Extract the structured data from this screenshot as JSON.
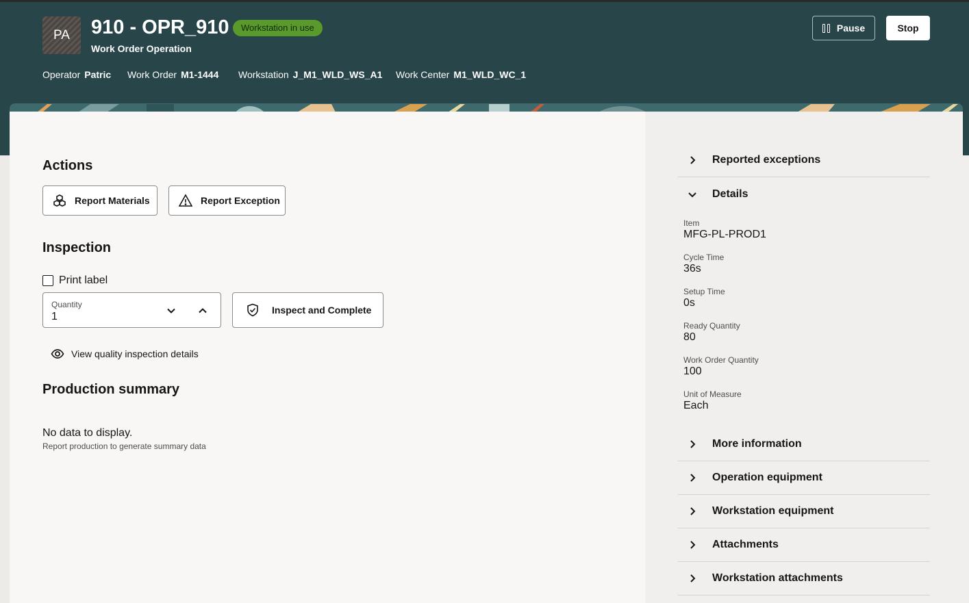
{
  "header": {
    "avatar_initials": "PA",
    "title": "910 - OPR_910",
    "status_badge": "Workstation in use",
    "subtitle": "Work Order Operation",
    "meta": [
      {
        "label": "Operator",
        "value": "Patric"
      },
      {
        "label": "Work Order",
        "value": "M1-1444"
      },
      {
        "label": "Workstation",
        "value": "J_M1_WLD_WS_A1"
      },
      {
        "label": "Work Center",
        "value": "M1_WLD_WC_1"
      }
    ],
    "pause_label": "Pause",
    "stop_label": "Stop"
  },
  "actions": {
    "heading": "Actions",
    "report_materials": "Report Materials",
    "report_exception": "Report Exception"
  },
  "inspection": {
    "heading": "Inspection",
    "print_label": "Print label",
    "print_label_checked": false,
    "quantity_label": "Quantity",
    "quantity_value": "1",
    "inspect_complete": "Inspect and Complete",
    "view_details": "View quality inspection details"
  },
  "production_summary": {
    "heading": "Production summary",
    "empty_title": "No data to display.",
    "empty_subtitle": "Report production to generate summary data"
  },
  "side_panel": {
    "reported_exceptions": "Reported exceptions",
    "details": "Details",
    "details_fields": [
      {
        "label": "Item",
        "value": "MFG-PL-PROD1"
      },
      {
        "label": "Cycle Time",
        "value": "36s"
      },
      {
        "label": "Setup Time",
        "value": "0s"
      },
      {
        "label": "Ready Quantity",
        "value": "80"
      },
      {
        "label": "Work Order Quantity",
        "value": "100"
      },
      {
        "label": "Unit of Measure",
        "value": "Each"
      }
    ],
    "more_information": "More information",
    "operation_equipment": "Operation equipment",
    "workstation_equipment": "Workstation equipment",
    "attachments": "Attachments",
    "workstation_attachments": "Workstation attachments"
  },
  "colors": {
    "header_bg": "#284549",
    "badge_bg": "#5a9a2c",
    "left_panel_bg": "#f8f7f5",
    "right_panel_bg": "#f1efed"
  }
}
